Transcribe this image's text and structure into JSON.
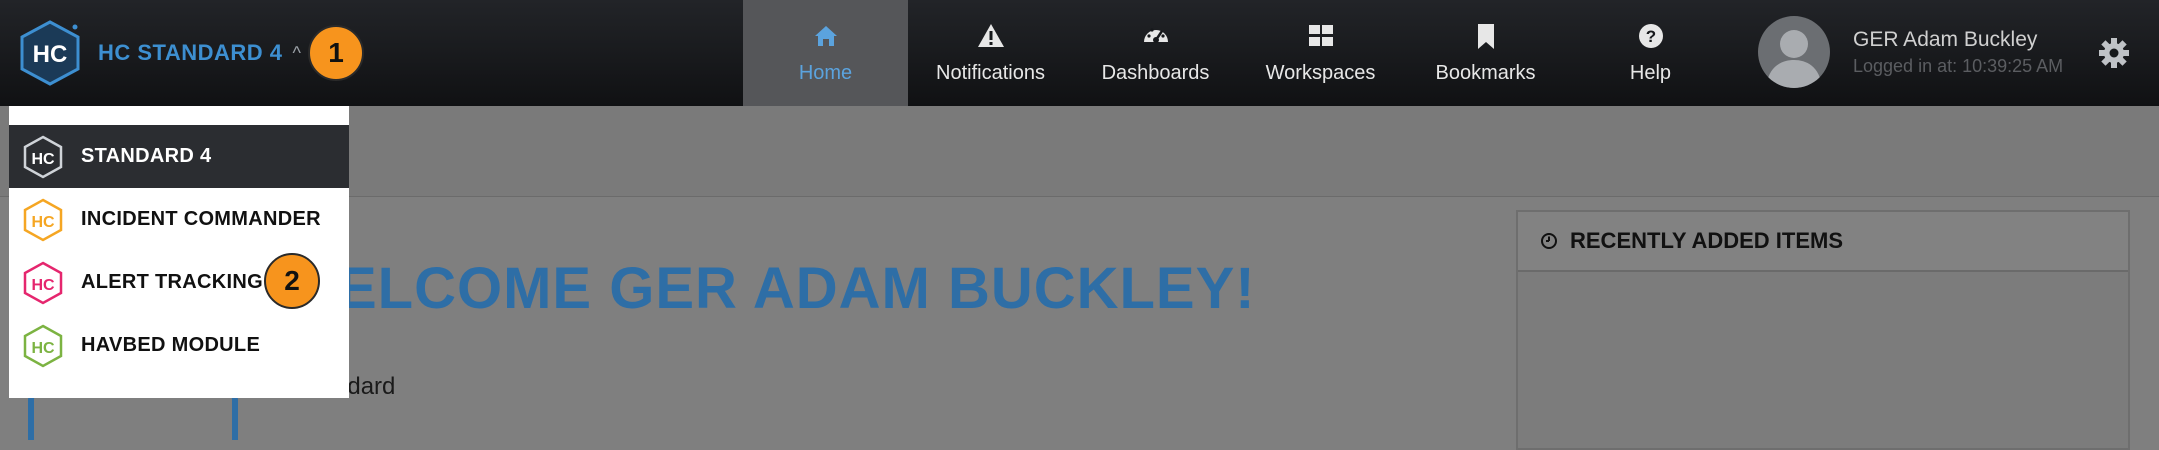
{
  "header": {
    "logo_text": "HC",
    "app_name": "HC STANDARD 4",
    "caret": "^",
    "badge_1": "1",
    "nav": [
      {
        "label": "Home",
        "icon": "home-icon"
      },
      {
        "label": "Notifications",
        "icon": "warning-icon"
      },
      {
        "label": "Dashboards",
        "icon": "gauge-icon"
      },
      {
        "label": "Workspaces",
        "icon": "grid-icon"
      },
      {
        "label": "Bookmarks",
        "icon": "bookmark-icon"
      },
      {
        "label": "Help",
        "icon": "help-icon"
      }
    ],
    "user": {
      "name": "GER Adam Buckley",
      "login": "Logged in at: 10:39:25 AM"
    }
  },
  "module_menu": {
    "items": [
      {
        "label": "STANDARD 4",
        "color": "#cfd3d8"
      },
      {
        "label": "INCIDENT COMMANDER",
        "color": "#f5a623"
      },
      {
        "label": "ALERT TRACKING",
        "color": "#e5266e"
      },
      {
        "label": "HAVBED MODULE",
        "color": "#7cb342"
      }
    ],
    "badge_2": "2"
  },
  "main": {
    "welcome": "ELCOME GER ADAM BUCKLEY!",
    "subtext": "ndard"
  },
  "panel": {
    "title": "RECENTLY ADDED ITEMS"
  },
  "colors": {
    "accent": "#3d8fd1",
    "badge": "#f7941d",
    "welcome": "#2e6ea6"
  }
}
